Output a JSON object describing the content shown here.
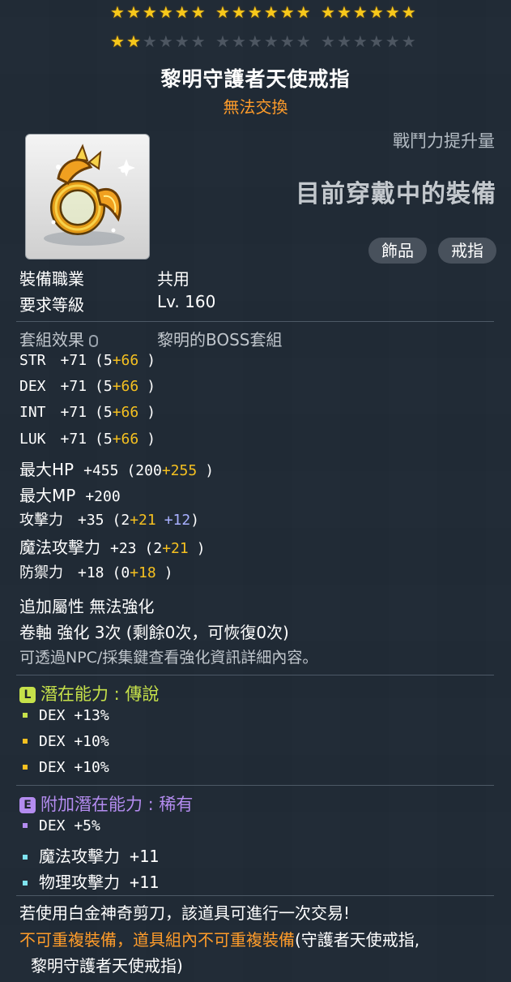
{
  "stars": {
    "filled": 2,
    "rows": 2,
    "groups": 3,
    "per_group": 6
  },
  "item": {
    "name": "黎明守護者天使戒指",
    "trade": "無法交換",
    "icon": "angel-ring-icon",
    "power_label": "戰鬥力提升量",
    "equipped_text": "目前穿戴中的裝備",
    "tags": [
      "飾品",
      "戒指"
    ]
  },
  "req": {
    "job_label": "裝備職業",
    "job_value": "共用",
    "level_label": "要求等級",
    "level_value": "Lv. 160"
  },
  "set": {
    "label": "套組效果",
    "value": "黎明的BOSS套組"
  },
  "stats": [
    {
      "name": "STR",
      "total": "+71",
      "open": "(5",
      "bonus": "+66",
      "extra": "",
      "close": ")"
    },
    {
      "name": "DEX",
      "total": "+71",
      "open": "(5",
      "bonus": "+66",
      "extra": "",
      "close": ")"
    },
    {
      "name": "INT",
      "total": "+71",
      "open": "(5",
      "bonus": "+66",
      "extra": "",
      "close": ")"
    },
    {
      "name": "LUK",
      "total": "+71",
      "open": "(5",
      "bonus": "+66",
      "extra": "",
      "close": ")"
    },
    {
      "name": "最大HP",
      "total": "+455",
      "open": "(200",
      "bonus": "+255",
      "extra": "",
      "close": ")"
    },
    {
      "name": "最大MP",
      "total": "+200",
      "open": "",
      "bonus": "",
      "extra": "",
      "close": ""
    },
    {
      "name": "攻擊力",
      "total": "+35",
      "open": "(2",
      "bonus": "+21",
      "extra": "+12",
      "close": ")"
    },
    {
      "name": "魔法攻擊力",
      "total": "+23",
      "open": "(2",
      "bonus": "+21",
      "extra": "",
      "close": ")"
    },
    {
      "name": "防禦力",
      "total": "+18",
      "open": "(0",
      "bonus": "+18",
      "extra": "",
      "close": ")"
    }
  ],
  "extra_attr": {
    "label": "追加屬性",
    "value": "無法強化"
  },
  "scroll": {
    "label": "卷軸 強化",
    "value": "3次 (剩餘0次，可恢復0次)"
  },
  "hint": "可透過NPC/採集鍵查看強化資訊詳細內容。",
  "potential": {
    "badge": "L",
    "title": "潛在能力 : 傳說",
    "color": "#c6e14a",
    "lines": [
      {
        "text": "DEX +13%",
        "bullet_color": "#c6e14a"
      },
      {
        "text": "DEX +10%",
        "bullet_color": "#f5c020"
      },
      {
        "text": "DEX +10%",
        "bullet_color": "#f5c020"
      }
    ]
  },
  "bonus_potential": {
    "badge": "E",
    "title": "附加潛在能力 : 稀有",
    "color": "#b48cf0",
    "lines": [
      {
        "text": "DEX +5%",
        "bullet_color": "#b48cf0"
      },
      {
        "text": "魔法攻擊力 +11",
        "bullet_color": "#7fe3f0"
      },
      {
        "text": "物理攻擊力 +11",
        "bullet_color": "#7fe3f0"
      }
    ]
  },
  "footer": {
    "scissors": "若使用白金神奇剪刀，該道具可進行一次交易!",
    "warning_orange": "不可重複裝備，道具組內不可重複裝備",
    "warning_rest": "(守護者天使戒指,",
    "warning_line2": "黎明守護者天使戒指)"
  }
}
